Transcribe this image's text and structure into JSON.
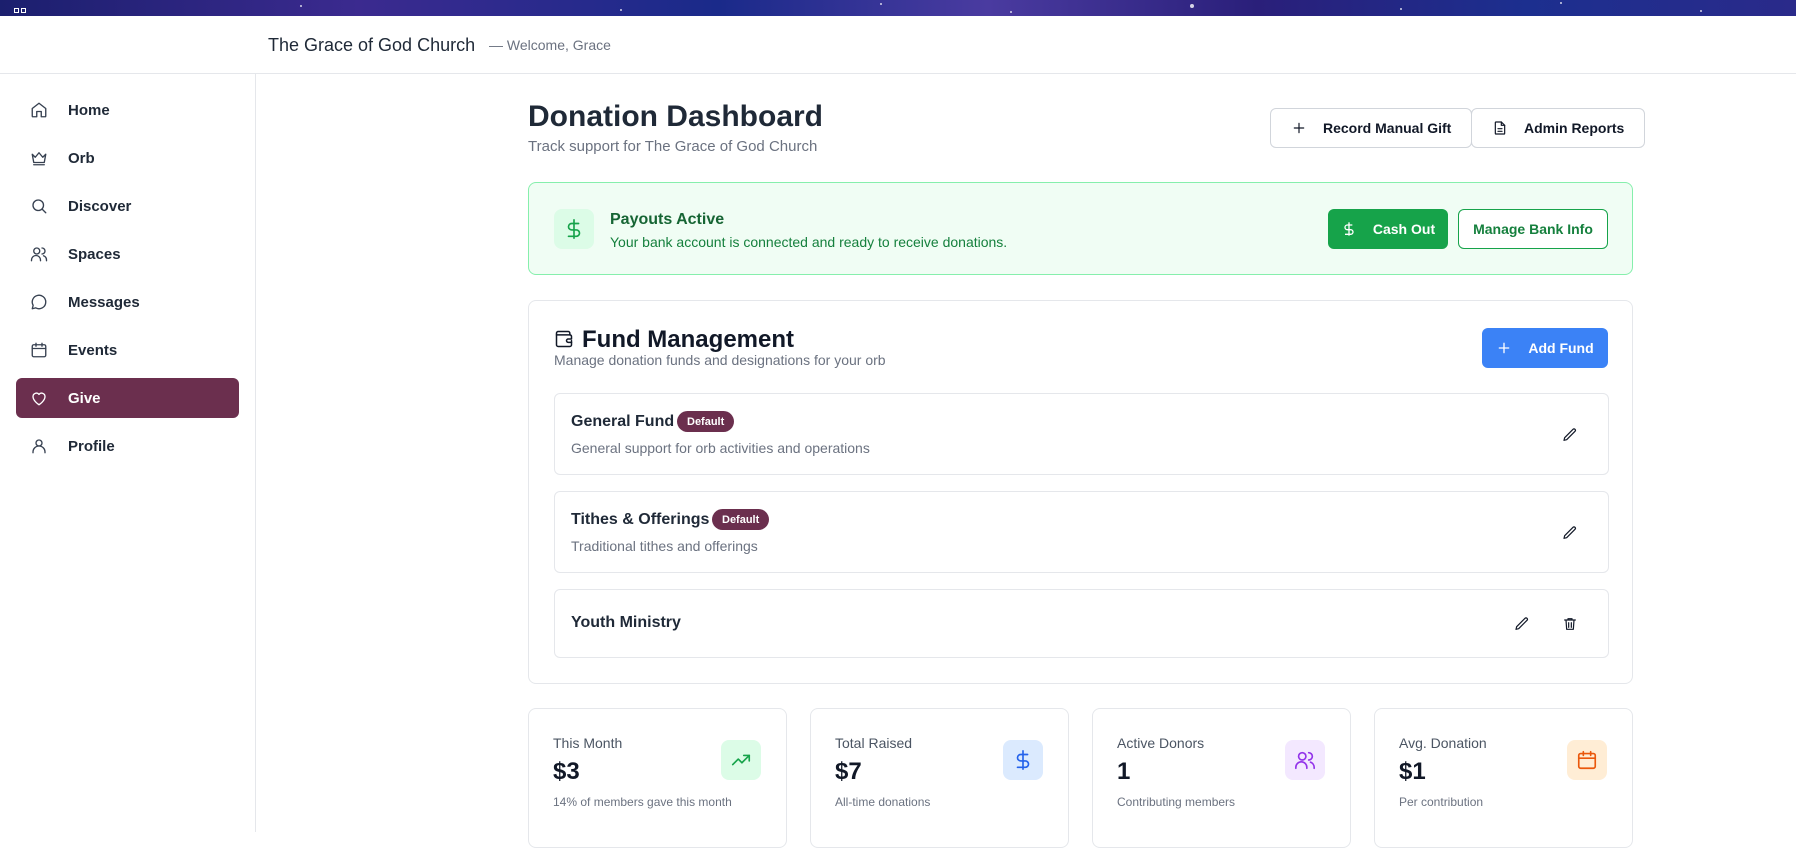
{
  "header": {
    "church_name": "The Grace of God Church",
    "welcome": "— Welcome, Grace"
  },
  "sidebar": {
    "items": [
      {
        "label": "Home",
        "icon": "home-icon"
      },
      {
        "label": "Orb",
        "icon": "crown-icon"
      },
      {
        "label": "Discover",
        "icon": "search-icon"
      },
      {
        "label": "Spaces",
        "icon": "users-icon"
      },
      {
        "label": "Messages",
        "icon": "message-icon"
      },
      {
        "label": "Events",
        "icon": "calendar-icon"
      },
      {
        "label": "Give",
        "icon": "heart-icon",
        "active": true
      },
      {
        "label": "Profile",
        "icon": "user-icon"
      }
    ]
  },
  "main": {
    "title": "Donation Dashboard",
    "subtitle": "Track support for The Grace of God Church",
    "record_gift_label": "Record Manual Gift",
    "admin_reports_label": "Admin Reports"
  },
  "payouts": {
    "title": "Payouts Active",
    "description": "Your bank account is connected and ready to receive donations.",
    "cash_out_label": "Cash Out",
    "manage_bank_label": "Manage Bank Info"
  },
  "funds": {
    "title": "Fund Management",
    "description": "Manage donation funds and designations for your orb",
    "add_label": "Add Fund",
    "items": [
      {
        "name": "General Fund",
        "badge": "Default",
        "description": "General support for orb activities and operations"
      },
      {
        "name": "Tithes & Offerings",
        "badge": "Default",
        "description": "Traditional tithes and offerings"
      },
      {
        "name": "Youth Ministry",
        "badge": "",
        "description": ""
      }
    ]
  },
  "stats": [
    {
      "label": "This Month",
      "value": "$3",
      "note": "14% of members gave this month",
      "icon": "trending-up-icon",
      "color": "#16a34a",
      "bg": "#dcfce7"
    },
    {
      "label": "Total Raised",
      "value": "$7",
      "note": "All-time donations",
      "icon": "dollar-icon",
      "color": "#2563eb",
      "bg": "#dbeafe"
    },
    {
      "label": "Active Donors",
      "value": "1",
      "note": "Contributing members",
      "icon": "users-icon",
      "color": "#9333ea",
      "bg": "#f3e8ff"
    },
    {
      "label": "Avg. Donation",
      "value": "$1",
      "note": "Per contribution",
      "icon": "calendar-icon",
      "color": "#ea580c",
      "bg": "#ffedd5"
    }
  ],
  "colors": {
    "brand": "#6b2f4e",
    "success": "#16a34a",
    "primary": "#3b82f6"
  }
}
